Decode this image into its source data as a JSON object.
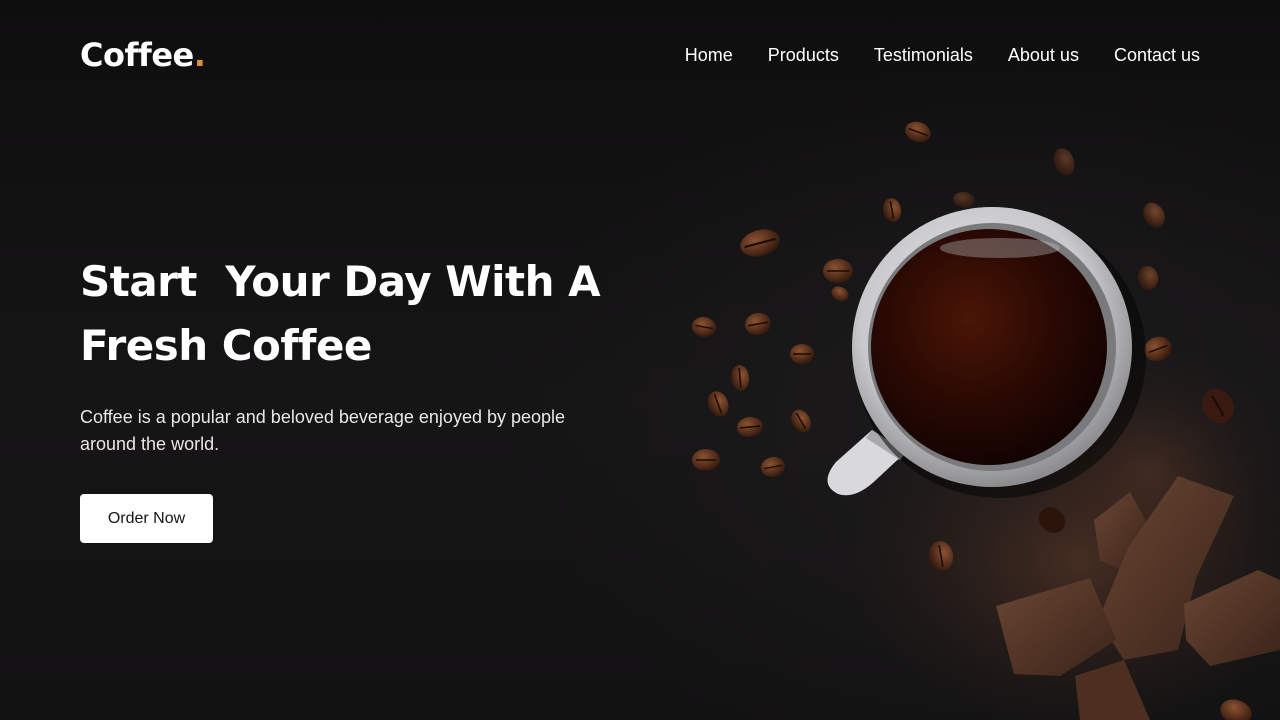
{
  "brand": {
    "name": "Coffee",
    "dot": ".",
    "accent_color": "#e08a3c"
  },
  "nav": {
    "items": [
      {
        "label": "Home"
      },
      {
        "label": "Products"
      },
      {
        "label": "Testimonials"
      },
      {
        "label": "About us"
      },
      {
        "label": "Contact us"
      }
    ]
  },
  "hero": {
    "title_line1": "Start  Your Day With A",
    "title_line2": "Fresh Coffee",
    "description": "Coffee is a popular and beloved beverage enjoyed by people around the world.",
    "cta_label": "Order Now"
  },
  "image": {
    "subject": "coffee-cup-with-beans-and-chocolate-photo"
  },
  "colors": {
    "background": "#141314",
    "text": "#ffffff",
    "button_bg": "#ffffff",
    "button_text": "#161516"
  }
}
